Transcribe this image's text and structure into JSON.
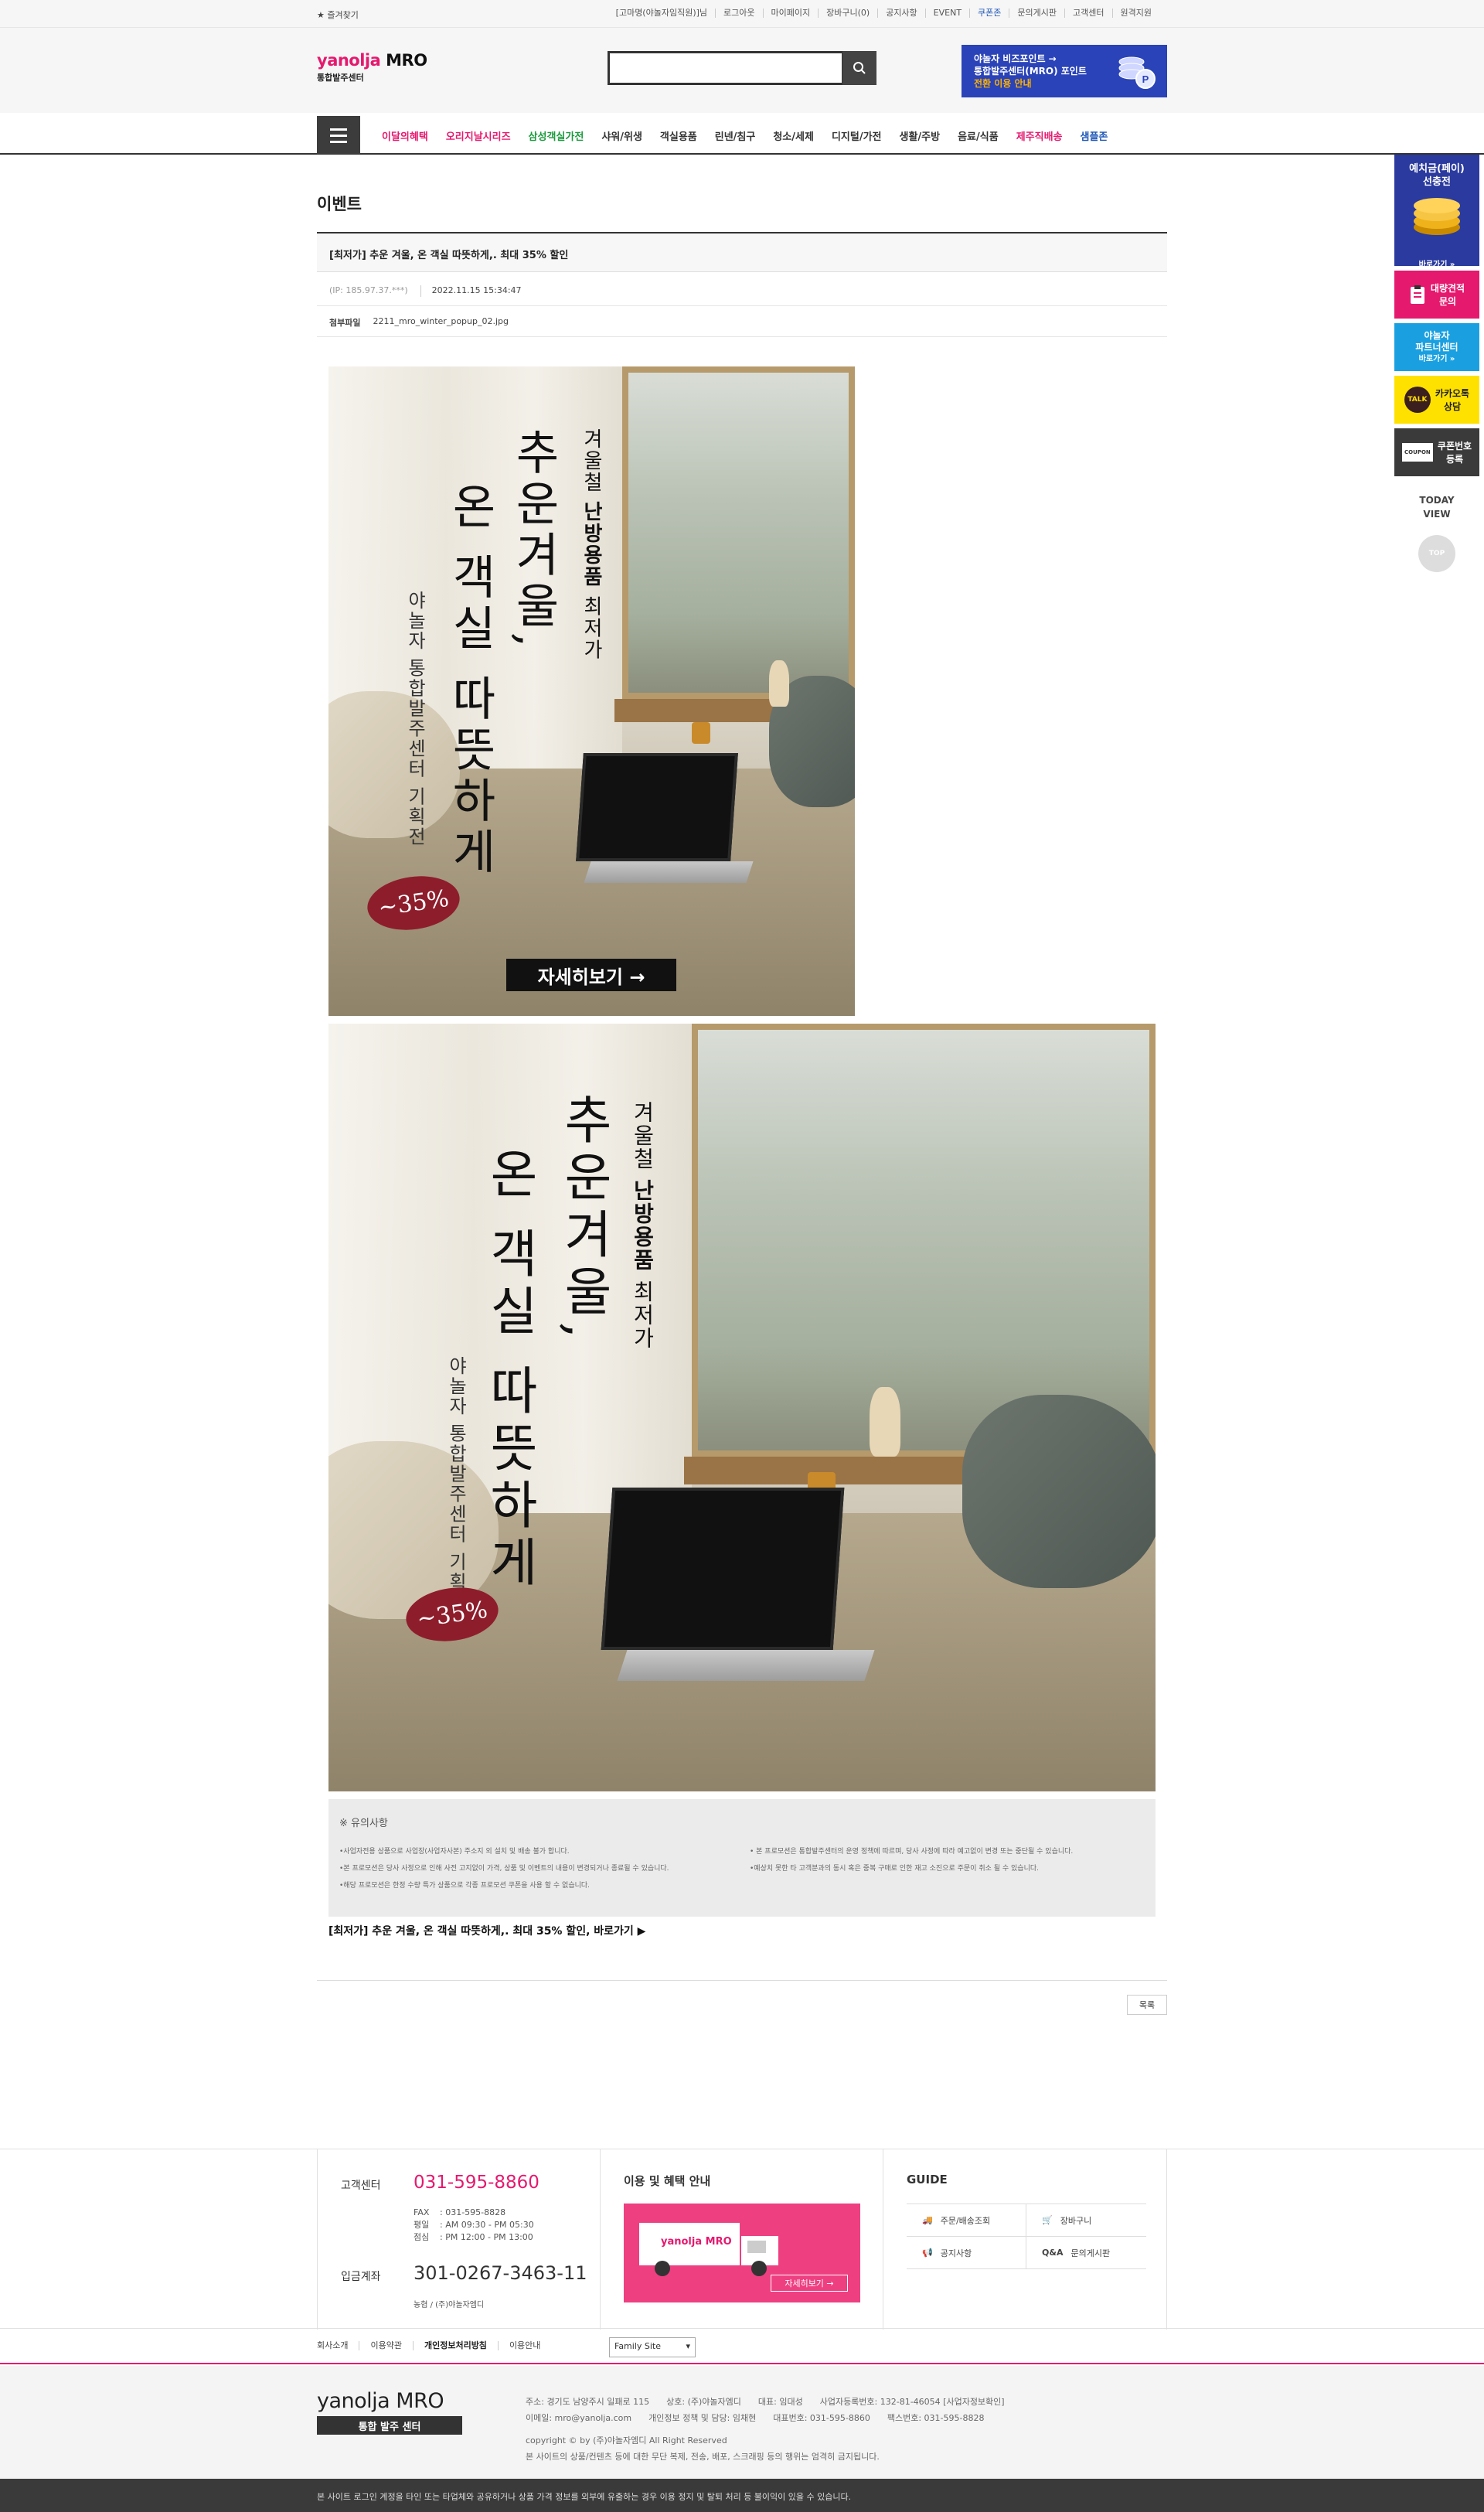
{
  "topbar": {
    "favorite": "★ 즐겨찾기",
    "links": [
      "[고마명(야놀자임직원)]님",
      "로그아웃",
      "마이페이지",
      "장바구니(0)",
      "공지사항",
      "EVENT",
      "쿠폰존",
      "문의게시판",
      "고객센터",
      "원격지원"
    ]
  },
  "header": {
    "brand_y": "yanolja",
    "brand_m": " MRO",
    "brand_sub": "통합발주센터",
    "search_placeholder": "",
    "promo_line1": "야놀자 비즈포인트 →",
    "promo_line2": "통합발주센터(MRO) 포인트",
    "promo_line3": "전환 이용 안내"
  },
  "nav": {
    "items": [
      "이달의혜택",
      "오리지날시리즈",
      "삼성객실가전",
      "샤워/위생",
      "객실용품",
      "린넨/침구",
      "청소/세제",
      "디지털/가전",
      "생활/주방",
      "음료/식품",
      "제주직배송",
      "샘플존"
    ]
  },
  "quick": {
    "deposit_line1": "예치금(페이)",
    "deposit_line2": "선충전",
    "deposit_more": "바로가기 »",
    "estimate_line1": "대량견적",
    "estimate_line2": "문의",
    "partner_line1": "야놀자",
    "partner_line2": "파트너센터",
    "partner_more": "바로가기 »",
    "talk_badge": "TALK",
    "talk_line1": "카카오톡",
    "talk_line2": "상담",
    "coupon_badge": "COUPON",
    "coupon_line1": "쿠폰번호",
    "coupon_line2": "등록",
    "today_line1": "TODAY",
    "today_line2": "VIEW",
    "top": "TOP"
  },
  "board": {
    "page_title": "이벤트",
    "post_title": "[최저가] 추운 겨울, 온 객실 따뜻하게,. 최대 35% 할인",
    "ip": "(IP: 185.97.37.***)",
    "date": "2022.11.15 15:34:47",
    "attach_label": "첨부파일",
    "attach_file": "2211_mro_winter_popup_02.jpg",
    "list_button": "목록"
  },
  "banner": {
    "headline1": "추운겨울,",
    "headline2": "온 객실 따뜻하게",
    "subline_pre": "겨울철 ",
    "subline_bold": "난방용품",
    "subline_post": " 최저가",
    "brandline": "야놀자 통합발주센터 기획전",
    "discount": "~35%",
    "detail_button": "자세히보기 →"
  },
  "notice": {
    "heading": "※ 유의사항",
    "left": [
      "•사업자전용 상품으로 사업장(사업자사본) 주소지 외 설치 및 배송 불가 합니다.",
      "•본 프로모션은 당사 사정으로 인해 사전 고지없이 가격, 상품 및 이벤트의 내용이 변경되거나 종료될 수 있습니다.",
      "•해당 프로모션은 한정 수량 특가 상품으로 각종 프로모션 쿠폰을 사용 할 수 없습니다."
    ],
    "right": [
      "• 본 프로모션은 통합발주센터의 운영 정책에 따르며, 당사 사정에 따라 예고없이 변경 또는 중단될 수 있습니다.",
      "•예상치 못한 타 고객분과의 동시 혹은 중복 구매로 인한 재고 소진으로 주문이 취소 될 수 있습니다."
    ],
    "link_text": "[최저가] 추운 겨울, 온 객실 따뜻하게,. 최대 35% 할인, 바로가기 ▶"
  },
  "footer": {
    "cs_title": "고객센터",
    "cs_phone": "031-595-8860",
    "fax_label": "FAX",
    "fax": ": 031-595-8828",
    "weekday_label": "평일",
    "weekday": ": AM 09:30 - PM 05:30",
    "lunch_label": "점심",
    "lunch": ": PM 12:00 - PM 13:00",
    "bank_title": "입금계좌",
    "bank_account": "301-0267-3463-11",
    "bank_owner": "농협 / (주)야놀자엠디",
    "benefit_title": "이용 및 혜택 안내",
    "truck_logo": "yanolja MRO",
    "truck_button": "자세히보기 →",
    "guide_title": "GUIDE",
    "guide_items": [
      "주문/배송조회",
      "장바구니",
      "공지사항",
      "문의게시판"
    ],
    "guide_qa": "Q&A",
    "links": [
      "회사소개",
      "이용약관",
      "개인정보처리방침",
      "이용안내"
    ],
    "family_site": "Family Site",
    "logo_name": "yanolja MRO",
    "logo_tag": "통합 발주 센터",
    "addr1_a": "주소: 경기도 남양주시 일패로 115",
    "addr1_b": "상호: (주)야놀자엠디",
    "addr1_c": "대표: 임대성",
    "addr1_d": "사업자등록번호: 132-81-46054 [사업자정보확인]",
    "addr2_a": "이메일: mro@yanolja.com",
    "addr2_b": "개인정보 정책 및 담당: 임채현",
    "addr2_c": "대표번호: 031-595-8860",
    "addr2_d": "팩스번호: 031-595-8828",
    "copyright": "copyright © by (주)야놀자엠디 All Right Reserved",
    "copyright2": "본 사이트의 상품/컨텐츠 등에 대한 무단 복제, 전송, 배포, 스크래핑 등의 행위는 엄격히 금지됩니다.",
    "warning": "본 사이트 로그인 계정을 타인 또는 타업체와 공유하거나 상품 가격 정보를 외부에 유출하는 경우 이용 정지 및 탈퇴 처리 등 불이익이 있을 수 있습니다."
  },
  "colors": {
    "brand_pink": "#e5196e",
    "promo_blue": "#2a43b8",
    "discount_red": "#8e1d2b"
  }
}
